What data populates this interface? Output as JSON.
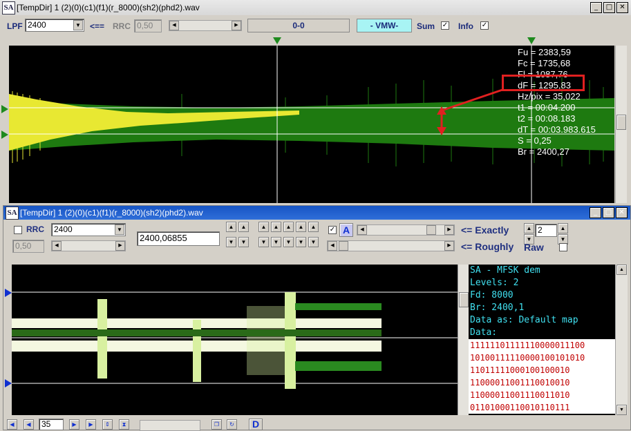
{
  "window1": {
    "title": "[TempDir] 1 (2)(0)(c1)(f1)(r_8000)(sh2)(phd2).wav",
    "app_icon": "SA",
    "toolbar": {
      "lpf_label": "LPF",
      "lpf_value": "2400",
      "arrow_label": "<==",
      "rrc_label": "RRC",
      "rrc_value": "0,50",
      "range_value": "0-0",
      "mode_label": "- VMW-",
      "sum_label": "Sum",
      "sum_checked": true,
      "info_label": "Info",
      "info_checked": true
    },
    "info_lines": [
      "Fu = 2383,59",
      "Fc = 1735,68",
      "Fl = 1087,76",
      "dF = 1295,83",
      "Hz/pix = 35,022",
      "t1 = 00:04.200",
      "t2 = 00:08.183",
      "dT = 00:03.983.615",
      "S = 0,25",
      "Br = 2400,27"
    ]
  },
  "window2": {
    "title": "[TempDir] 1 (2)(0)(c1)(f1)(r_8000)(sh2)(phd2).wav",
    "app_icon": "SA",
    "rrc_label": "RRC",
    "rrc_checked": false,
    "rrc_value": "2400",
    "rolloff_value": "0,50",
    "baud_value": "2400,06855",
    "a_label": "A",
    "a_checked": true,
    "exactly_label": "<= Exactly",
    "roughly_label": "<= Roughly",
    "levels_spin": "2",
    "raw_label": "Raw",
    "raw_checked": false,
    "panel_lines": [
      "SA - MFSK dem",
      "Levels: 2",
      "Fd: 8000",
      "Br: 2400,1",
      "Data as: Default map",
      "Data:"
    ],
    "data_bits": [
      "11111101111110000011100",
      "10100111110000100101010",
      "11011111000100100010",
      "11000011001110010010",
      "11000011001110011010",
      "01101000110010110111"
    ],
    "page_value": "35",
    "d_button": "D"
  },
  "colors": {
    "yellow_trace": "#e8e832",
    "green_trace": "#1e7a10",
    "mono_text": "#40e0f0",
    "bits_text": "#c00000",
    "marker_blue": "#1030d0",
    "highlight_red": "#e02020"
  }
}
